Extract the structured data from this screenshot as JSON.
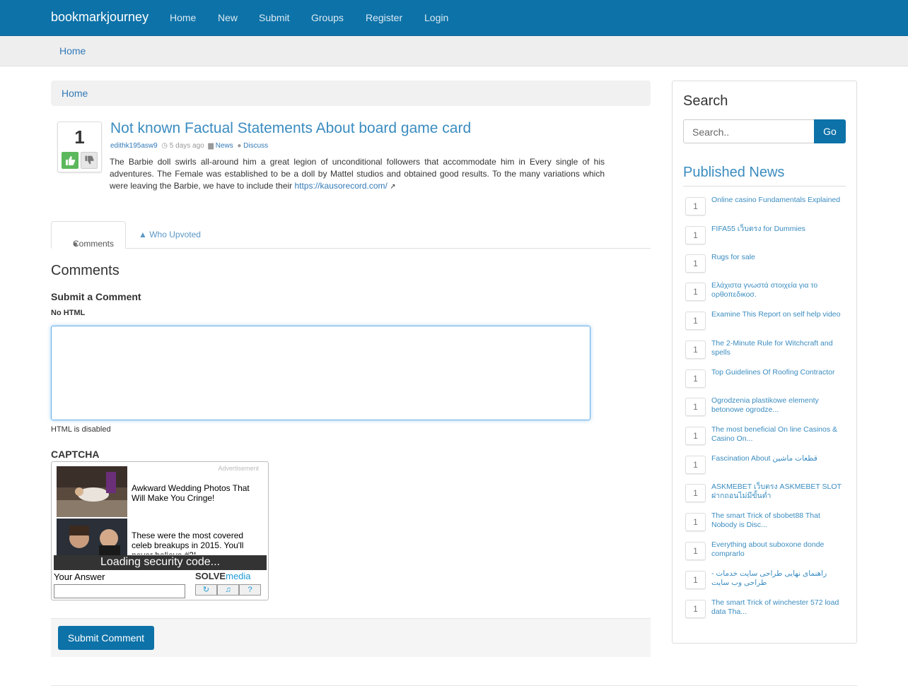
{
  "navbar": {
    "brand": "bookmarkjourney",
    "links": [
      "Home",
      "New",
      "Submit",
      "Groups",
      "Register",
      "Login"
    ]
  },
  "subbar": {
    "link": "Home"
  },
  "breadcrumb": {
    "label": "Home"
  },
  "post": {
    "votes": "1",
    "title": "Not known Factual Statements About board game card",
    "author": "edithk195asw9",
    "time": "5 days ago",
    "category": "News",
    "discuss": "Discuss",
    "body": "The Barbie doll swirls all-around him a great legion of unconditional followers that accommodate him in Every single of his adventures. The Female was established to be a doll by Mattel studios and obtained good results. To the many variations which were leaving the Barbie, we have to include their",
    "link": "https://kausorecord.com/"
  },
  "tabs": {
    "comments": "Comments",
    "upvoted": "Who Upvoted"
  },
  "comments": {
    "heading": "Comments",
    "submit_heading": "Submit a Comment",
    "no_html": "No HTML",
    "html_disabled": "HTML is disabled",
    "captcha_heading": "CAPTCHA",
    "submit_label": "Submit Comment"
  },
  "captcha": {
    "advertisement": "Advertisement",
    "ad1": "Awkward Wedding Photos That Will Make You Cringe!",
    "ad2": "These were the most covered celeb breakups in 2015. You'll never believe #3!",
    "loading": "Loading security code...",
    "answer_label": "Your Answer",
    "logo_solve": "SOLVE",
    "logo_media": "media"
  },
  "sidebar": {
    "search_heading": "Search",
    "search_placeholder": "Search..",
    "go_label": "Go",
    "published_heading": "Published News",
    "news": [
      {
        "count": "1",
        "title": "Online casino Fundamentals Explained"
      },
      {
        "count": "1",
        "title": "FIFA55 เว็บตรง for Dummies"
      },
      {
        "count": "1",
        "title": "Rugs for sale"
      },
      {
        "count": "1",
        "title": "Ελάχιστα γνωστά στοιχεία για το ορθοπεδικοσ."
      },
      {
        "count": "1",
        "title": "Examine This Report on self help video"
      },
      {
        "count": "1",
        "title": "The 2-Minute Rule for Witchcraft and spells"
      },
      {
        "count": "1",
        "title": "Top Guidelines Of Roofing Contractor"
      },
      {
        "count": "1",
        "title": "Ogrodzenia plastikowe elementy betonowe ogrodze..."
      },
      {
        "count": "1",
        "title": "The most beneficial On line Casinos & Casino On..."
      },
      {
        "count": "1",
        "title": "Fascination About قطعات ماشین"
      },
      {
        "count": "1",
        "title": "ASKMEBET เว็บตรง ASKMEBET SLOT ฝากถอนไม่มีขั้นต่ำ"
      },
      {
        "count": "1",
        "title": "The smart Trick of sbobet88 That Nobody is Disc..."
      },
      {
        "count": "1",
        "title": "Everything about suboxone donde comprarlo"
      },
      {
        "count": "1",
        "title": "- راهنمای نهایی طراحی سایت خدمات طراحی وب سایت"
      },
      {
        "count": "1",
        "title": "The smart Trick of winchester 572 load data Tha..."
      }
    ]
  }
}
